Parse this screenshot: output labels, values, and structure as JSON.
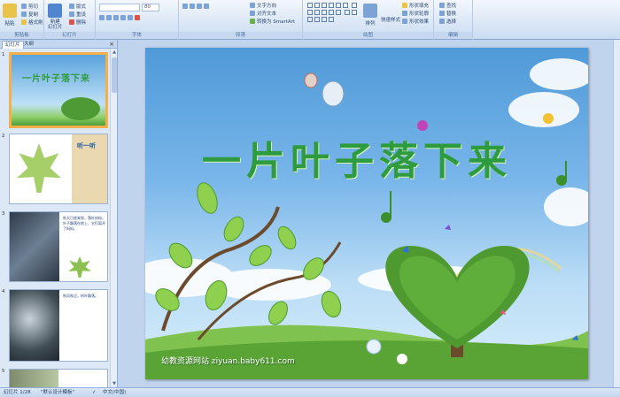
{
  "ribbon": {
    "clipboard": {
      "paste": "粘贴",
      "cut": "剪切",
      "copy": "复制",
      "format_painter": "格式刷",
      "label": "剪贴板"
    },
    "slides": {
      "new_slide": "新建\n幻灯片",
      "layout": "版式",
      "reset": "重设",
      "delete": "删除",
      "label": "幻灯片"
    },
    "font": {
      "font_size": "80",
      "label": "字体"
    },
    "paragraph": {
      "text_direction": "文字方向",
      "align_text": "对齐文本",
      "smartart": "转换为 SmartArt",
      "label": "段落"
    },
    "drawing": {
      "arrange": "排列",
      "quick_styles": "快速样式",
      "shape_fill": "形状填充",
      "shape_outline": "形状轮廓",
      "shape_effects": "形状效果",
      "label": "绘图"
    },
    "editing": {
      "find": "查找",
      "replace": "替换",
      "select": "选择",
      "label": "编辑"
    }
  },
  "pane": {
    "tab_slides": "幻灯片",
    "tab_outline": "大纲",
    "thumbnails": [
      {
        "num": "1",
        "text": "一片叶子落下来"
      },
      {
        "num": "2",
        "text": "听一听"
      },
      {
        "num": "3",
        "text": "秋天已经来到，落叶纷纷。叶子飘落在地上，它们离开了妈妈。"
      },
      {
        "num": "4",
        "text": "秋风吹过，树叶飘落。"
      },
      {
        "num": "5",
        "text": ""
      }
    ]
  },
  "slide": {
    "title": "一片叶子落下来",
    "footer": "幼教资源网站  ziyuan.baby611.com"
  },
  "status": {
    "slide_pos": "幻灯片 1/28",
    "theme": "\"默认设计模板\"",
    "language": "中文(中国)"
  },
  "colors": {
    "title_green": "#2e9b3e",
    "ribbon_bg": "#dbe7f6",
    "selection": "#f4b04b"
  }
}
